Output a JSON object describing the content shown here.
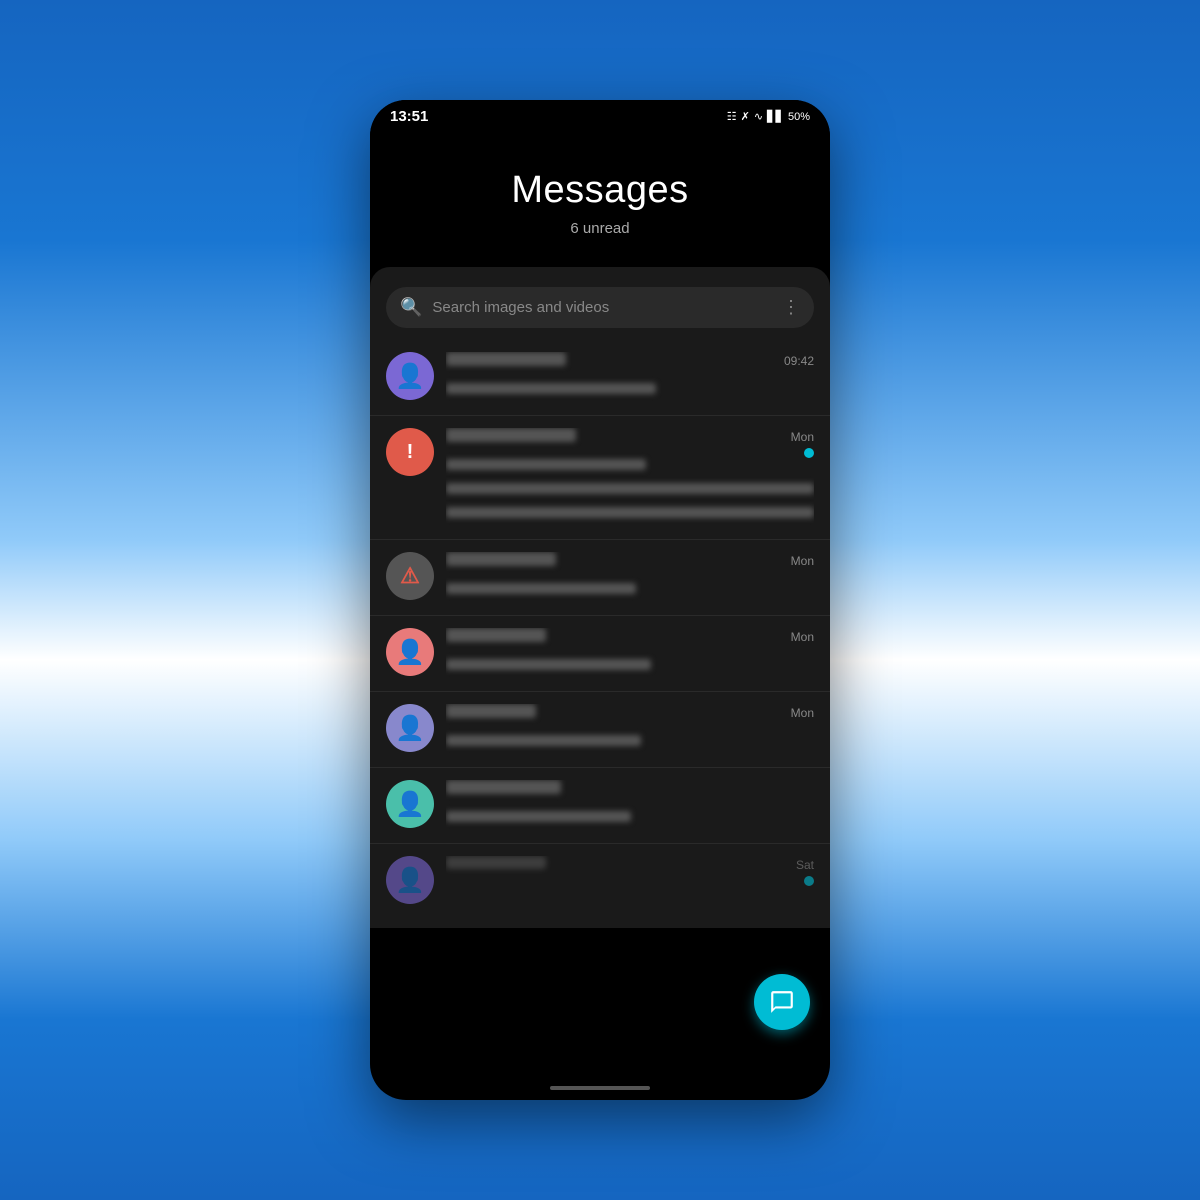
{
  "background": {
    "color": "#1a6fd4"
  },
  "phone": {
    "status_bar": {
      "time": "13:51",
      "battery": "50%",
      "icons": "bluetooth wifi signal"
    },
    "header": {
      "title": "Messages",
      "subtitle": "6 unread"
    },
    "search": {
      "placeholder": "Search images and videos",
      "search_icon": "search",
      "more_icon": "more-vertical"
    },
    "messages": [
      {
        "id": 1,
        "avatar_color": "purple",
        "avatar_type": "person",
        "time": "09:42",
        "has_unread": false
      },
      {
        "id": 2,
        "avatar_color": "red",
        "avatar_type": "warning",
        "time": "Mon",
        "has_unread": true
      },
      {
        "id": 3,
        "avatar_color": "dark-red",
        "avatar_type": "warning",
        "time": "Mon",
        "has_unread": false
      },
      {
        "id": 4,
        "avatar_color": "pink",
        "avatar_type": "person",
        "time": "Mon",
        "has_unread": false
      },
      {
        "id": 5,
        "avatar_color": "light-purple",
        "avatar_type": "person",
        "time": "Mon",
        "has_unread": false
      },
      {
        "id": 6,
        "avatar_color": "teal",
        "avatar_type": "person",
        "time": "",
        "has_unread": false
      },
      {
        "id": 7,
        "avatar_color": "purple",
        "avatar_type": "person",
        "time": "Sat",
        "has_unread": true
      }
    ],
    "fab": {
      "icon": "compose-message",
      "label": "New Message"
    }
  }
}
